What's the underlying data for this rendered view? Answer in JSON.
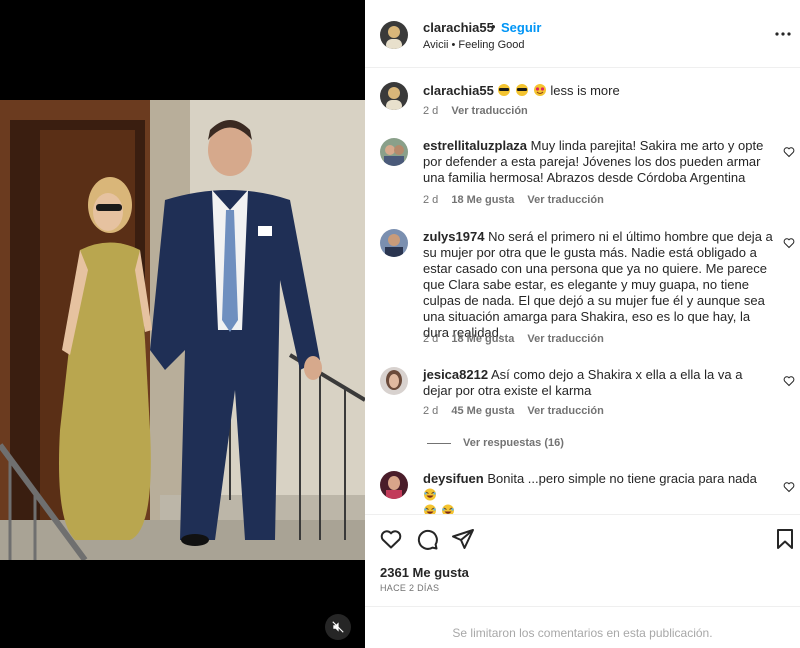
{
  "post": {
    "username": "clarachia55",
    "follow_label": "Seguir",
    "separator": "•",
    "music": "Avicii • Feeling Good",
    "caption_text": "less is more",
    "caption_age": "2 d",
    "caption_translate": "Ver traducción"
  },
  "comments": [
    {
      "username": "estrellitaluzplaza",
      "text": "Muy linda parejita! Sakira me arto y opte por defender a esta pareja! Jóvenes los dos pueden armar una familia hermosa! Abrazos desde Córdoba Argentina",
      "age": "2 d",
      "likes": "18 Me gusta",
      "translate": "Ver traducción"
    },
    {
      "username": "zulys1974",
      "text": "No será el primero ni el último hombre que deja a su mujer por otra que le gusta más. Nadie está obligado a estar casado con una persona que ya no quiere. Me parece que Clara sabe estar, es elegante y muy guapa, no tiene culpas de nada. El que dejó a su mujer fue él y aunque sea una situación amarga para Shakira, eso es lo que hay, la dura realidad.",
      "age": "2 d",
      "likes": "18 Me gusta",
      "translate": "Ver traducción"
    },
    {
      "username": "jesica8212",
      "text": "Así como dejo a Shakira x ella a ella la va a dejar por otra existe el karma",
      "age": "2 d",
      "likes": "45 Me gusta",
      "translate": "Ver traducción"
    },
    {
      "username": "deysifuen",
      "text": "Bonita ...pero simple no tiene gracia para nada"
    }
  ],
  "replies_label": "Ver respuestas (16)",
  "likes_count": "2361 Me gusta",
  "time_ago": "HACE 2 DÍAS",
  "comments_disabled": "Se limitaron los comentarios en esta publicación.",
  "icons": [
    "heart-icon",
    "comment-icon",
    "share-icon",
    "bookmark-icon",
    "more-icon",
    "mute-icon"
  ],
  "colors": {
    "follow": "#0095f6",
    "secondary": "#737373",
    "muted": "#a8a8a8"
  }
}
